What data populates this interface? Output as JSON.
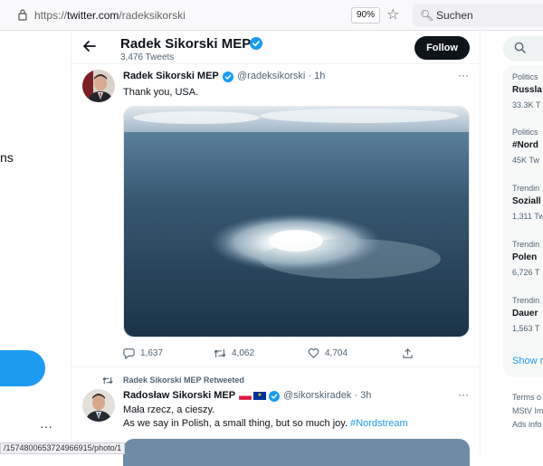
{
  "browser": {
    "url_prefix": "https://",
    "url_host": "twitter.com",
    "url_path": "/radeksikorski",
    "zoom": "90%",
    "search_label": "Suchen"
  },
  "left_nav": {
    "partial_label": "ns"
  },
  "profile": {
    "name": "Radek Sikorski MEP",
    "tweet_count": "3,476 Tweets",
    "follow_label": "Follow"
  },
  "tweets": [
    {
      "author_name": "Radek Sikorski MEP",
      "handle": "@radeksikorski · 1h",
      "text": "Thank you, USA.",
      "actions": {
        "replies": "1,637",
        "retweets": "4,062",
        "likes": "4,704"
      }
    },
    {
      "retweeted_by": "Radek Sikorski MEP Retweeted",
      "author_name": "Radosław Sikorski MEP",
      "handle": "@sikorskiradek · 3h",
      "text_line1": "Mała rzecz, a cieszy.",
      "text_line2": "As we say in Polish, a small thing, but so much joy.",
      "hashtag": "#Nordstream"
    }
  ],
  "status_bar": {
    "url": "/1574800653724966915/photo/1"
  },
  "trends": [
    {
      "category": "Politics",
      "name": "Russla",
      "count": "33.3K T"
    },
    {
      "category": "Politics",
      "name": "#Nord",
      "count": "45K Tw"
    },
    {
      "category": "Trendin",
      "name": "Soziall",
      "count": "1,311 Tw"
    },
    {
      "category": "Trendin",
      "name": "Polen",
      "count": "6,726 T"
    },
    {
      "category": "Trendin",
      "name": "Dauer",
      "count": "1,563 T"
    }
  ],
  "show_more": "Show m",
  "footer": [
    "Terms o",
    "MStV Im",
    "Ads info"
  ],
  "colors": {
    "accent": "#1d9bf0",
    "text": "#0f1419",
    "muted": "#536471"
  }
}
